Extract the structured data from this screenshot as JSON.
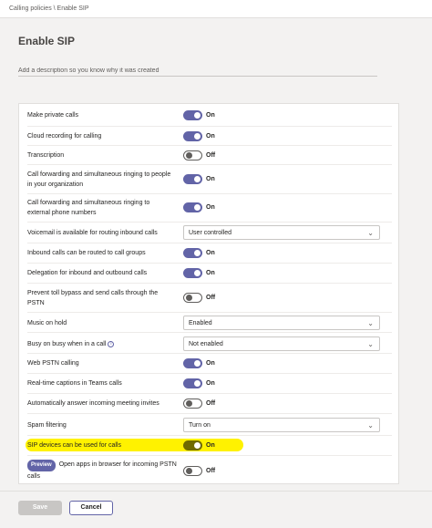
{
  "breadcrumb": "Calling policies \\ Enable SIP",
  "title": "Enable SIP",
  "description_placeholder": "Add a description so you know why it was created",
  "settings": [
    {
      "label": "Make private calls",
      "type": "toggle",
      "state": "On"
    },
    {
      "label": "Cloud recording for calling",
      "type": "toggle",
      "state": "On"
    },
    {
      "label": "Transcription",
      "type": "toggle",
      "state": "Off"
    },
    {
      "label": "Call forwarding and simultaneous ringing to people in your organization",
      "type": "toggle",
      "state": "On"
    },
    {
      "label": "Call forwarding and simultaneous ringing to external phone numbers",
      "type": "toggle",
      "state": "On"
    },
    {
      "label": "Voicemail is available for routing inbound calls",
      "type": "select",
      "value": "User controlled"
    },
    {
      "label": "Inbound calls can be routed to call groups",
      "type": "toggle",
      "state": "On"
    },
    {
      "label": "Delegation for inbound and outbound calls",
      "type": "toggle",
      "state": "On"
    },
    {
      "label": "Prevent toll bypass and send calls through the PSTN",
      "type": "toggle",
      "state": "Off"
    },
    {
      "label": "Music on hold",
      "type": "select",
      "value": "Enabled"
    },
    {
      "label": "Busy on busy when in a call",
      "type": "select",
      "value": "Not enabled"
    },
    {
      "label": "Web PSTN calling",
      "type": "toggle",
      "state": "On"
    },
    {
      "label": "Real-time captions in Teams calls",
      "type": "toggle",
      "state": "On"
    },
    {
      "label": "Automatically answer incoming meeting invites",
      "type": "toggle",
      "state": "Off"
    },
    {
      "label": "Spam filtering",
      "type": "select",
      "value": "Turn on"
    },
    {
      "label": "SIP devices can be used for calls",
      "type": "toggle",
      "state": "On"
    },
    {
      "label": "Open apps in browser for incoming PSTN calls",
      "type": "toggle",
      "state": "Off",
      "badge": "Preview"
    }
  ],
  "buttons": {
    "save": "Save",
    "cancel": "Cancel"
  },
  "colors": {
    "accent": "#6264a7",
    "highlight": "#fff200"
  }
}
